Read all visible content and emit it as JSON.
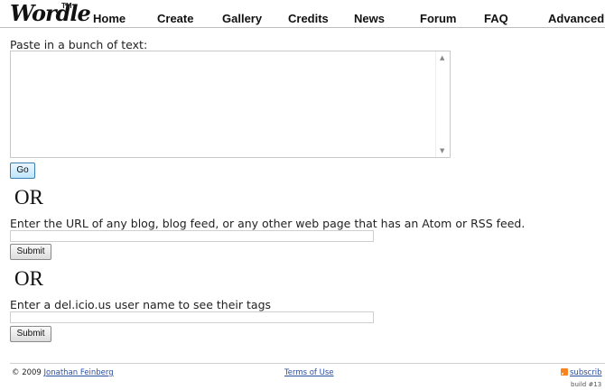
{
  "header": {
    "logo": "Wordle",
    "tm": "TM",
    "nav": [
      "Home",
      "Create",
      "Gallery",
      "Credits",
      "News",
      "Forum",
      "FAQ",
      "Advanced"
    ]
  },
  "form": {
    "paste_label": "Paste in a bunch of text:",
    "go_button": "Go",
    "or1": "OR",
    "url_label": "Enter the URL of any blog, blog feed, or any other web page that has an Atom or RSS feed.",
    "submit1": "Submit",
    "or2": "OR",
    "delicious_label": "Enter a del.icio.us user name to see their tags",
    "submit2": "Submit"
  },
  "footer": {
    "copyright_prefix": "© 2009",
    "author": "Jonathan Feinberg",
    "terms": "Terms of Use",
    "subscribe": "subscrib",
    "build": "build #13"
  }
}
